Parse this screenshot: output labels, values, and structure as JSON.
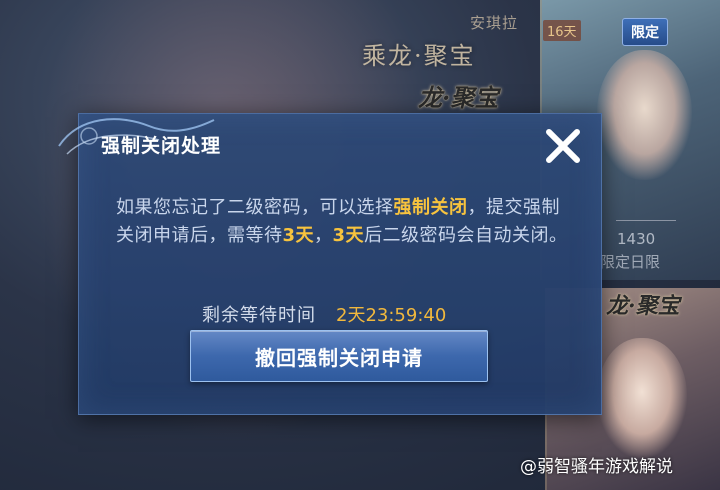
{
  "background": {
    "top_text": "安琪拉",
    "title": "乘龙·聚宝",
    "logo_text_1": "龙·聚宝",
    "logo_text_2": "龙·聚宝",
    "card_days_badge": "16天",
    "limited_badge": "限定",
    "price": "1430",
    "limited_text": "限定日限"
  },
  "dialog": {
    "title": "强制关闭处理",
    "message": {
      "part1": "如果您忘记了二级密码，可以选择",
      "highlight1": "强制关闭",
      "part2": "，提交强制关闭申请后，需等待",
      "highlight2": "3天",
      "part3": "，",
      "highlight3": "3天",
      "part4": "后二级密码会自动关闭。"
    },
    "timer_label": "剩余等待时间",
    "timer_value": "2天23:59:40",
    "revoke_button": "撤回强制关闭申请",
    "close_icon": "close-icon"
  },
  "watermark": "@弱智骚年游戏解说",
  "colors": {
    "highlight": "#f7c33e",
    "timer": "#f1b83d",
    "dialog_bg": "#2e4976",
    "button": "#3d68ad"
  }
}
